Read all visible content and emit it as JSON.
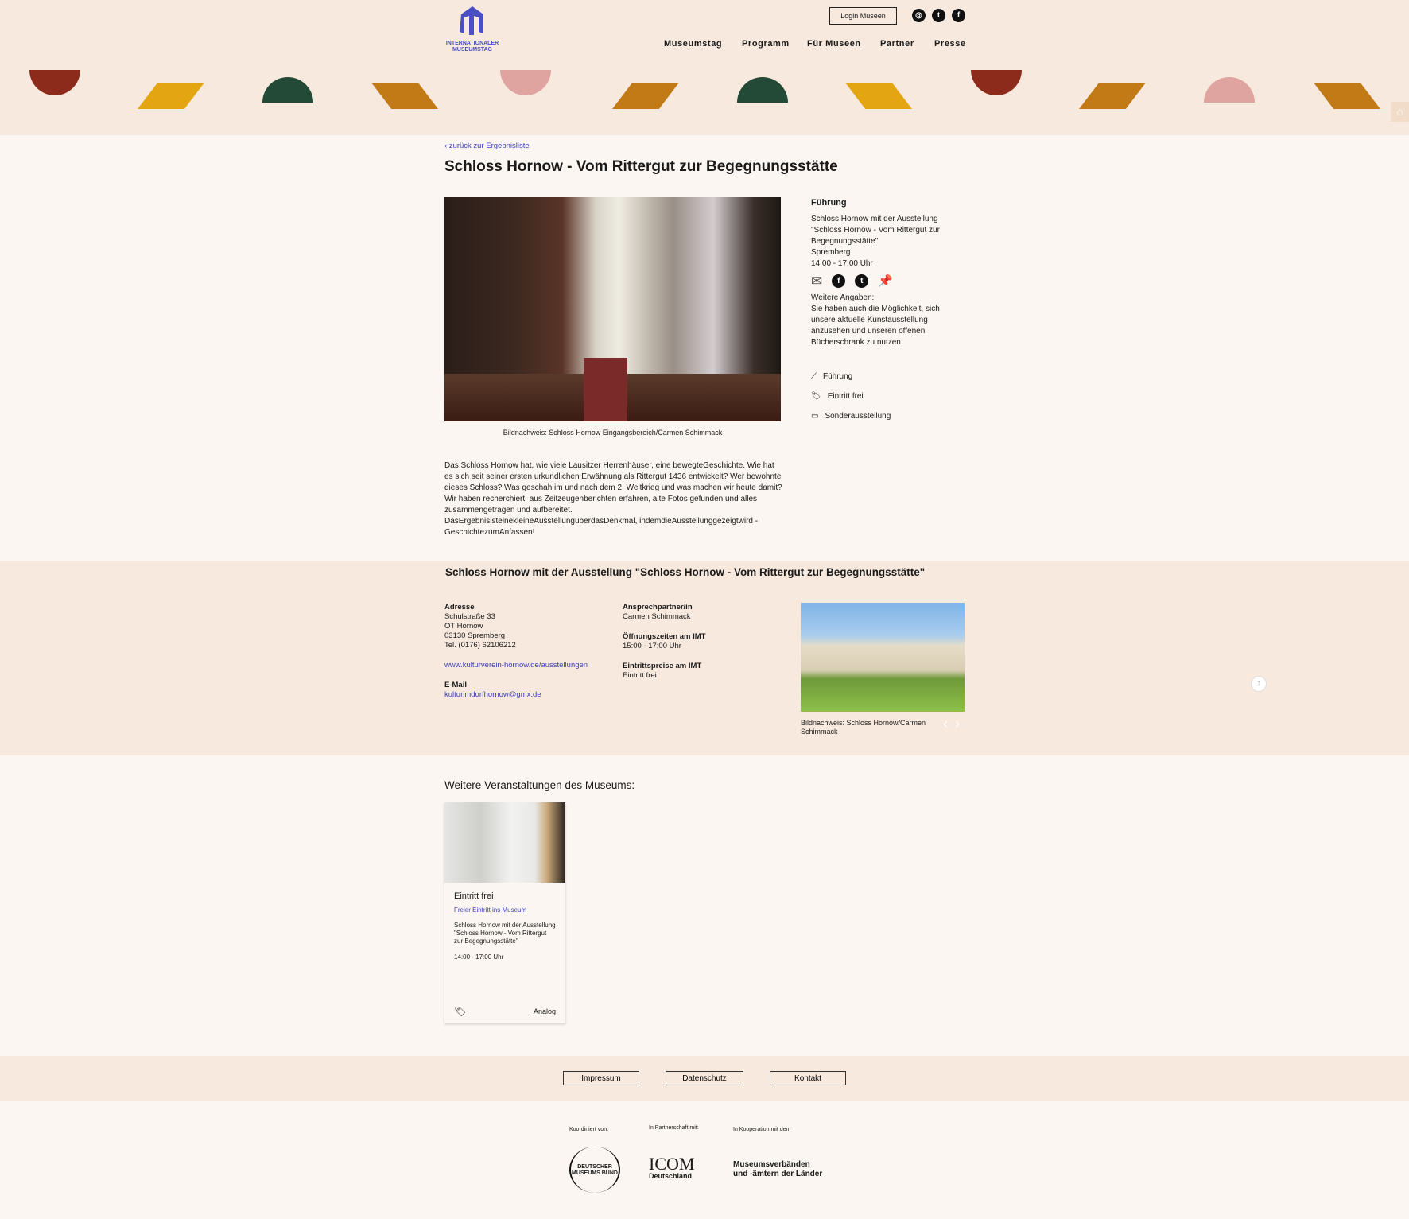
{
  "header": {
    "logo_line1": "INTERNATIONALER",
    "logo_line2": "MUSEUMSTAG",
    "login": "Login Museen",
    "social": [
      "instagram-icon",
      "twitter-icon",
      "facebook-icon"
    ],
    "nav": [
      "Museumstag",
      "Programm",
      "Für Museen",
      "Partner",
      "Presse"
    ]
  },
  "colors": {
    "accent": "#4a4fc4",
    "red": "#8c2a1c",
    "yellow": "#e3a512",
    "green": "#234a36",
    "orange": "#c27a17",
    "pink": "#dfa3a0",
    "band": "#f7e9de"
  },
  "back_link": "zurück zur Ergebnisliste",
  "title": "Schloss Hornow - Vom Rittergut zur Begegnungsstätte",
  "image_caption": "Bildnachweis: Schloss Hornow Eingangsbereich/Carmen Schimmack",
  "sidebar": {
    "type": "Führung",
    "venue_line1": "Schloss Hornow mit der Ausstellung",
    "venue_line2": "\"Schloss Hornow - Vom Rittergut zur",
    "venue_line3": "Begegnungsstätte\"",
    "city": "Spremberg",
    "time": "14:00 - 17:00 Uhr",
    "more_label": "Weitere Angaben:",
    "more_text": "Sie haben auch die Möglichkeit, sich unsere aktuelle Kunstausstellung anzusehen und unseren offenen Bücherschrank zu nutzen.",
    "tags": [
      "Führung",
      "Eintritt frei",
      "Sonderausstellung"
    ]
  },
  "description": [
    "Das Schloss Hornow hat, wie viele Lausitzer Herrenhäuser, eine bewegteGeschichte. Wie hat es sich seit seiner ersten urkundlichen Erwähnung als Rittergut 1436 entwickelt? Wer bewohnte dieses Schloss? Was geschah im und nach dem 2. Weltkrieg und was machen wir heute damit? Wir haben recherchiert, aus Zeitzeugenberichten erfahren, alte Fotos gefunden und alles zusammengetragen und aufbereitet.",
    "DasErgebnisisteinekleineAusstellungüberdasDenkmal, indemdieAusstellunggezeigtwird - GeschichtezumAnfassen!"
  ],
  "museum": {
    "name": "Schloss Hornow mit der Ausstellung \"Schloss Hornow - Vom Rittergut zur Begegnungsstätte\"",
    "address_label": "Adresse",
    "address": [
      "Schulstraße 33",
      "OT Hornow",
      "03130 Spremberg",
      "Tel. (0176) 62106212"
    ],
    "website": "www.kulturverein-hornow.de/ausstellungen",
    "email_label": "E-Mail",
    "email": "kulturimdorfhornow@gmx.de",
    "contact_label": "Ansprechpartner/in",
    "contact": "Carmen Schimmack",
    "hours_label": "Öffnungszeiten am IMT",
    "hours": "15:00 - 17:00 Uhr",
    "price_label": "Eintrittspreise am IMT",
    "price": "Eintritt frei",
    "image_caption": "Bildnachweis: Schloss Hornow/Carmen Schimmack"
  },
  "more_events": {
    "heading": "Weitere Veranstaltungen des Museums:",
    "card": {
      "title": "Eintritt frei",
      "subtitle": "Freier Eintritt ins Museum",
      "venue": "Schloss Hornow mit der Ausstellung \"Schloss Hornow - Vom Rittergut zur Begegnungsstätte\"",
      "time": "14:00 - 17:00 Uhr",
      "format": "Analog"
    }
  },
  "footer": {
    "links": [
      "Impressum",
      "Datenschutz",
      "Kontakt"
    ],
    "coordinated": "Koordiniert von:",
    "partnership": "In Partnerschaft mit:",
    "cooperation": "In Kooperation mit den:",
    "dmb_logo": "DEUTSCHER MUSEUMS BUND",
    "icom_logo": "ICOM",
    "icom_sub": "Deutschland",
    "mv_line1": "Museumsverbänden",
    "mv_line2": "und -ämtern der Länder"
  }
}
